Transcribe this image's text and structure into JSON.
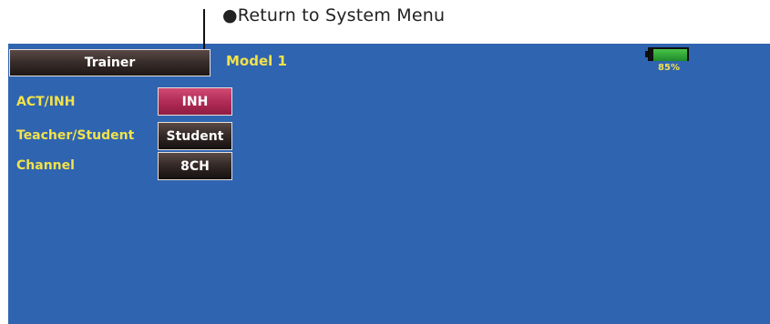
{
  "annotation": {
    "text": "●Return to System Menu"
  },
  "header": {
    "title_button": "Trainer",
    "model_name": "Model 1",
    "battery_percent_text": "85%",
    "battery_level": 0.85
  },
  "settings": {
    "act_inh": {
      "label": "ACT/INH",
      "value": "INH"
    },
    "teacher_student": {
      "label": "Teacher/Student",
      "value": "Student"
    },
    "channel": {
      "label": "Channel",
      "value": "8CH"
    }
  },
  "colors": {
    "screen_bg": "#2f64b1",
    "label_yellow": "#f2e24a",
    "inh_button": "#b22c58",
    "dark_button": "#352a28",
    "battery_green": "#2fa83a"
  }
}
